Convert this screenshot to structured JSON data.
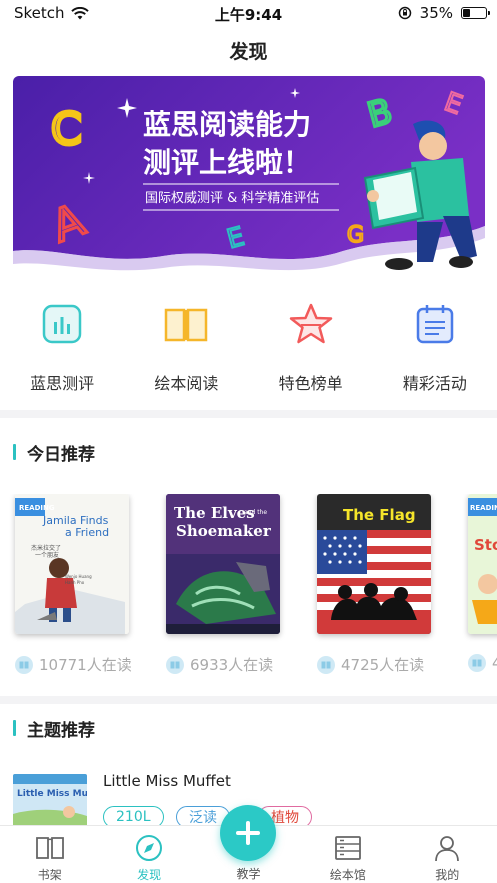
{
  "status_bar": {
    "carrier": "Sketch",
    "time": "上午9:44",
    "battery": "35%",
    "battery_level": 0.35
  },
  "nav": {
    "title": "发现"
  },
  "banner": {
    "headline_line1": "蓝思阅读能力",
    "headline_line2": "测评上线啦！",
    "subline": "国际权威测评 & 科学精准评估",
    "letters": [
      "C",
      "A",
      "E",
      "B",
      "E",
      "G"
    ]
  },
  "categories": [
    {
      "label": "蓝思测评",
      "icon": "chart-icon",
      "color": "#3ac8c8"
    },
    {
      "label": "绘本阅读",
      "icon": "book-open-icon",
      "color": "#f5b62a"
    },
    {
      "label": "特色榜单",
      "icon": "star-icon",
      "color": "#f25a5a"
    },
    {
      "label": "精彩活动",
      "icon": "calendar-icon",
      "color": "#4a7be8"
    }
  ],
  "today_section": {
    "title": "今日推荐"
  },
  "books": [
    {
      "cover_title": "Jamila Finds a Friend",
      "readers": "10771人在读"
    },
    {
      "cover_title": "The Elves and the Shoemaker",
      "readers": "6933人在读"
    },
    {
      "cover_title": "The Flag",
      "readers": "4725人在读"
    },
    {
      "cover_title": "Sto",
      "readers": "4"
    }
  ],
  "theme_section": {
    "title": "主题推荐"
  },
  "theme_item": {
    "cover_title": "Little Miss Muffet",
    "title": "Little Miss Muffet",
    "tags": [
      "210L",
      "泛读",
      "植物"
    ]
  },
  "tabbar": {
    "tabs": [
      {
        "label": "书架",
        "icon": "bookshelf-icon"
      },
      {
        "label": "发现",
        "icon": "compass-icon",
        "active": true
      },
      {
        "label": "教学",
        "icon": "plus-icon"
      },
      {
        "label": "绘本馆",
        "icon": "library-icon"
      },
      {
        "label": "我的",
        "icon": "user-icon"
      }
    ]
  },
  "colors": {
    "accent": "#2bc1c1",
    "banner_purple": "#5b2bb8"
  }
}
